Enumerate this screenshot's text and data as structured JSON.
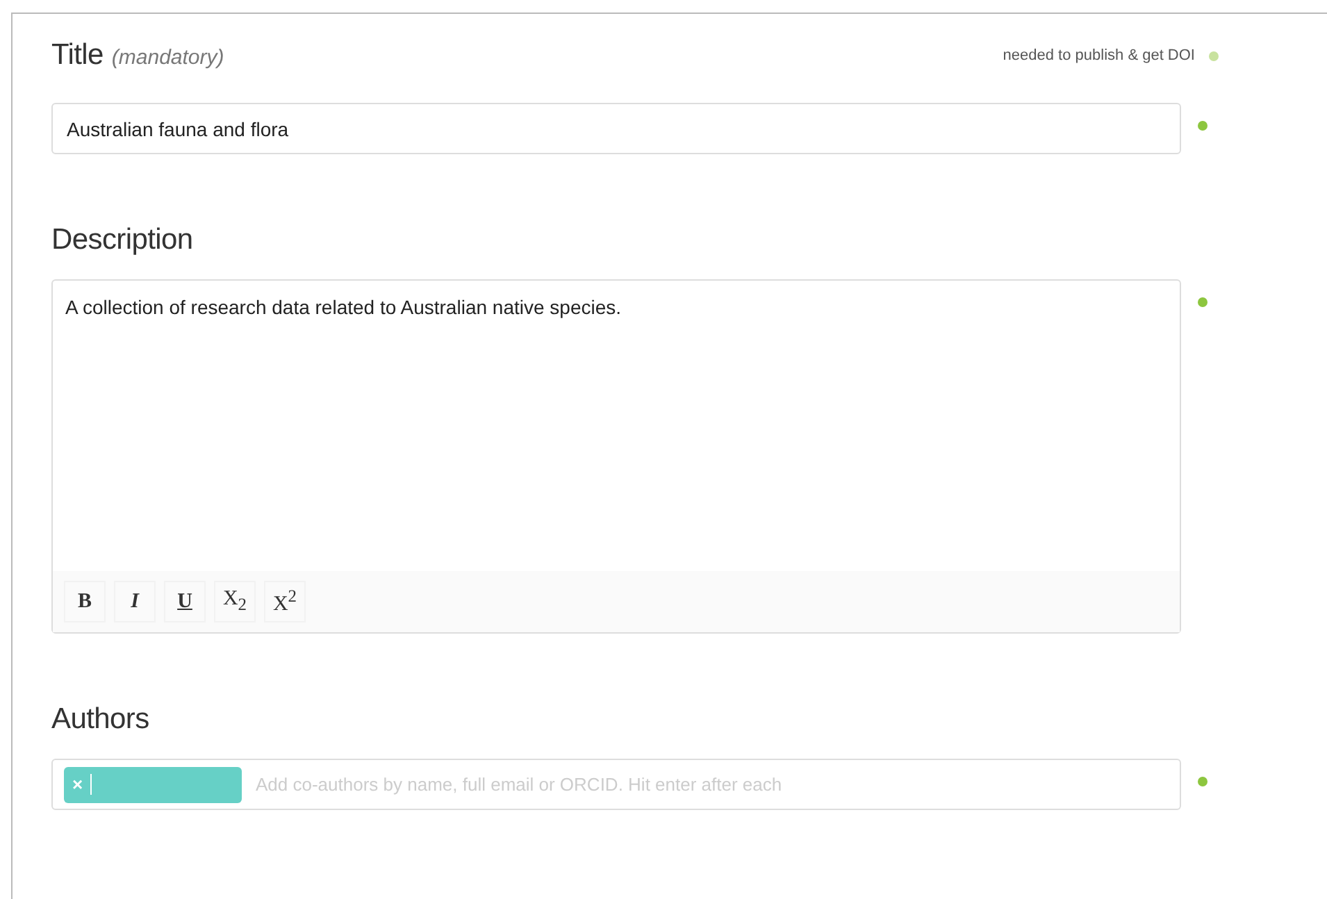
{
  "title_section": {
    "label": "Title",
    "hint": "(mandatory)",
    "legend": {
      "text": "needed to publish & get DOI",
      "color": "#c8e29e"
    },
    "value": "Australian fauna and flora",
    "dot": {
      "color": "#8dc63f"
    }
  },
  "description_section": {
    "label": "Description",
    "value": "A collection of research data related to Australian native species.",
    "dot": {
      "color": "#8dc63f"
    },
    "toolbar": [
      {
        "kind": "bold",
        "label": "B"
      },
      {
        "kind": "italic",
        "label": "I"
      },
      {
        "kind": "underline",
        "label": "U"
      },
      {
        "kind": "plain",
        "label": "X$_{2}$"
      },
      {
        "kind": "plain",
        "label": "X$^{2}$"
      }
    ]
  },
  "authors_section": {
    "label": "Authors",
    "chips": [
      {
        "remove": "×"
      }
    ],
    "placeholder": "Add co-authors by name, full email or ORCID. Hit enter after each",
    "dot": {
      "color": "#8dc63f"
    }
  }
}
